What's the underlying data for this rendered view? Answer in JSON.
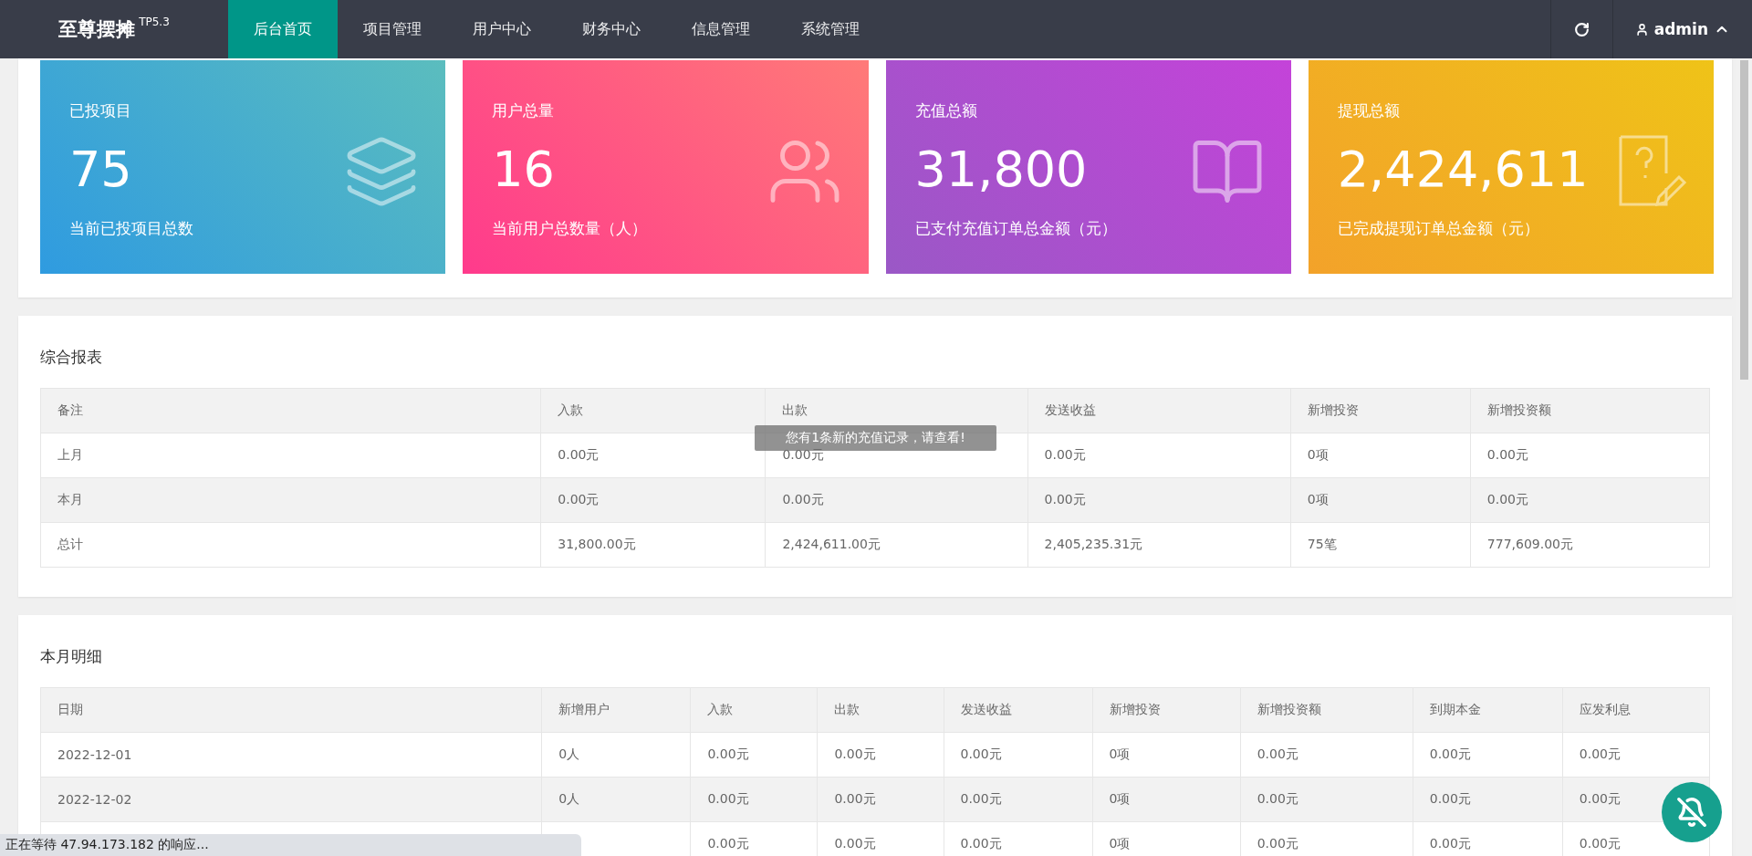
{
  "header": {
    "logo": "至尊摆摊",
    "version": "TP5.3",
    "nav": [
      {
        "label": "后台首页",
        "selected": true
      },
      {
        "label": "项目管理",
        "selected": false
      },
      {
        "label": "用户中心",
        "selected": false
      },
      {
        "label": "财务中心",
        "selected": false
      },
      {
        "label": "信息管理",
        "selected": false
      },
      {
        "label": "系统管理",
        "selected": false
      }
    ],
    "user": "admin"
  },
  "stat_cards": [
    {
      "kind": "layers",
      "title": "已投项目",
      "value": "75",
      "caption": "当前已投项目总数"
    },
    {
      "kind": "users",
      "title": "用户总量",
      "value": "16",
      "caption": "当前用户总数量（人）"
    },
    {
      "kind": "book",
      "title": "充值总额",
      "value": "31,800",
      "caption": "已支付充值订单总金额（元）"
    },
    {
      "kind": "note",
      "title": "提现总额",
      "value": "2,424,611",
      "caption": "已完成提现订单总金额（元）"
    }
  ],
  "summary_report": {
    "title": "综合报表",
    "columns": [
      "备注",
      "入款",
      "出款",
      "发送收益",
      "新增投资",
      "新增投资额"
    ],
    "rows": [
      [
        "上月",
        "0.00元",
        "0.00元",
        "0.00元",
        "0项",
        "0.00元"
      ],
      [
        "本月",
        "0.00元",
        "0.00元",
        "0.00元",
        "0项",
        "0.00元"
      ],
      [
        "总计",
        "31,800.00元",
        "2,424,611.00元",
        "2,405,235.31元",
        "75笔",
        "777,609.00元"
      ]
    ]
  },
  "toast": "您有1条新的充值记录，请查看!",
  "monthly_detail": {
    "title": "本月明细",
    "columns": [
      "日期",
      "新增用户",
      "入款",
      "出款",
      "发送收益",
      "新增投资",
      "新增投资额",
      "到期本金",
      "应发利息"
    ],
    "rows": [
      [
        "2022-12-01",
        "0人",
        "0.00元",
        "0.00元",
        "0.00元",
        "0项",
        "0.00元",
        "0.00元",
        "0.00元"
      ],
      [
        "2022-12-02",
        "0人",
        "0.00元",
        "0.00元",
        "0.00元",
        "0项",
        "0.00元",
        "0.00元",
        "0.00元"
      ],
      [
        null,
        null,
        "0.00元",
        "0.00元",
        "0.00元",
        "0项",
        "0.00元",
        "0.00元",
        "0.00元"
      ]
    ]
  },
  "browser_status": "正在等待 47.94.173.182 的响应..."
}
